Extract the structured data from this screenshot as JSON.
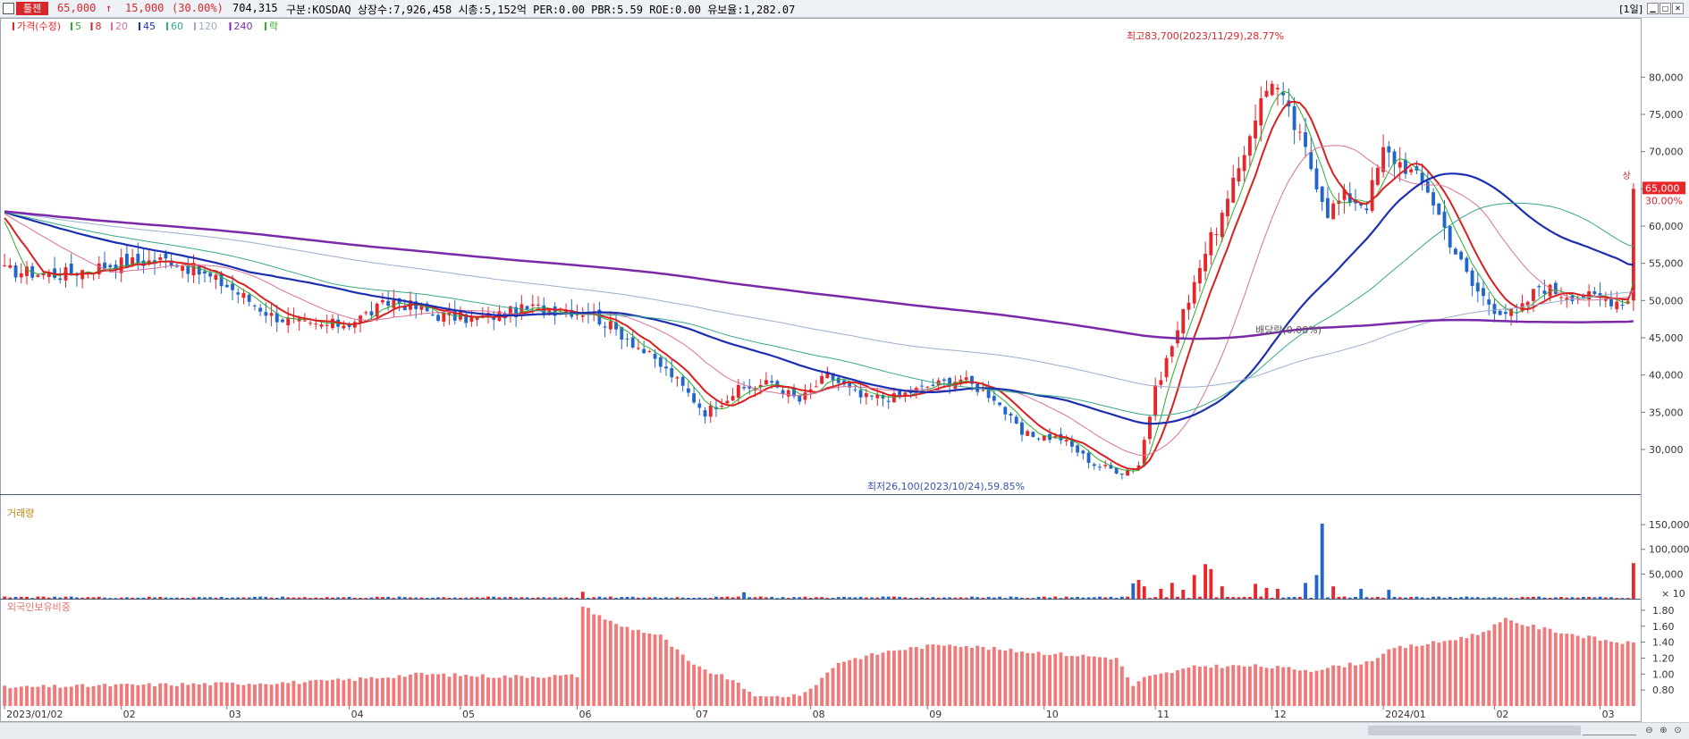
{
  "header": {
    "stock_name": "툴젠",
    "price": "65,000",
    "change_arrow": "↑",
    "change": "15,000",
    "change_pct": "(30.00%)",
    "volume": "704,315",
    "info": "구분:KOSDAQ 상장수:7,926,458 시총:5,152억 PER:0.00 PBR:5.59 ROE:0.00 유보율:1,282.07",
    "period": "[1일]"
  },
  "colors": {
    "up": "#e8252a",
    "down": "#2266cc",
    "ma5": "#2eaa2e",
    "ma8": "#d92020",
    "ma20": "#d9709a",
    "ma45": "#1c2fb0",
    "ma60": "#36a88a",
    "ma120": "#9aaed0",
    "ma240": "#7a2aa8",
    "foreign": "#f07a7a"
  },
  "chart_data": [
    {
      "type": "candlestick",
      "name": "price",
      "legend": [
        {
          "label": "가격(수정)",
          "color": "#e8252a"
        },
        {
          "label": "5",
          "color": "#2eaa2e"
        },
        {
          "label": "8",
          "color": "#d92020"
        },
        {
          "label": "20",
          "color": "#d9709a"
        },
        {
          "label": "45",
          "color": "#1c2fb0"
        },
        {
          "label": "60",
          "color": "#36a88a"
        },
        {
          "label": "120",
          "color": "#9aaed0"
        },
        {
          "label": "240",
          "color": "#7a2aa8"
        },
        {
          "label": "락",
          "color": "#2eaa2e"
        }
      ],
      "ylim": [
        24000,
        87000
      ],
      "yticks": [
        30000,
        35000,
        40000,
        45000,
        50000,
        55000,
        60000,
        65000,
        70000,
        75000,
        80000
      ],
      "ytick_labels": [
        "30,000",
        "35,000",
        "40,000",
        "45,000",
        "50,000",
        "55,000",
        "60,000",
        "65,000",
        "70,000",
        "75,000",
        "80,000"
      ],
      "x_labels": [
        "2023/01/02",
        "02",
        "03",
        "04",
        "05",
        "06",
        "07",
        "08",
        "09",
        "10",
        "11",
        "12",
        "2024/01",
        "02",
        "03"
      ],
      "x_label_days": [
        0,
        21,
        40,
        62,
        82,
        103,
        124,
        145,
        166,
        187,
        207,
        228,
        248,
        268,
        287
      ],
      "close_path": [
        [
          0,
          54000
        ],
        [
          10,
          53500
        ],
        [
          20,
          55000
        ],
        [
          30,
          55500
        ],
        [
          40,
          52000
        ],
        [
          48,
          48000
        ],
        [
          55,
          46500
        ],
        [
          62,
          47000
        ],
        [
          70,
          50000
        ],
        [
          78,
          48000
        ],
        [
          85,
          47500
        ],
        [
          95,
          49000
        ],
        [
          105,
          48500
        ],
        [
          112,
          45000
        ],
        [
          120,
          40000
        ],
        [
          126,
          35000
        ],
        [
          132,
          38000
        ],
        [
          138,
          39000
        ],
        [
          143,
          36500
        ],
        [
          148,
          40000
        ],
        [
          154,
          37000
        ],
        [
          160,
          37000
        ],
        [
          166,
          38500
        ],
        [
          172,
          39500
        ],
        [
          178,
          37000
        ],
        [
          183,
          32000
        ],
        [
          190,
          31500
        ],
        [
          196,
          28000
        ],
        [
          201,
          27000
        ],
        [
          204,
          28000
        ],
        [
          207,
          38000
        ],
        [
          211,
          46000
        ],
        [
          215,
          55000
        ],
        [
          220,
          63000
        ],
        [
          225,
          75000
        ],
        [
          228,
          80000
        ],
        [
          231,
          75000
        ],
        [
          234,
          70000
        ],
        [
          238,
          62000
        ],
        [
          241,
          64000
        ],
        [
          245,
          63000
        ],
        [
          248,
          70000
        ],
        [
          252,
          68000
        ],
        [
          256,
          65000
        ],
        [
          260,
          58000
        ],
        [
          264,
          52000
        ],
        [
          268,
          49000
        ],
        [
          272,
          48000
        ],
        [
          276,
          52000
        ],
        [
          280,
          51000
        ],
        [
          285,
          50500
        ],
        [
          290,
          50000
        ],
        [
          292,
          50000
        ],
        [
          293,
          65000
        ]
      ],
      "high_annotation": "최고83,700(2023/11/29),28.77%",
      "low_annotation": "최저26,100(2023/10/24),59.85%",
      "right_annotation": "배당락(0.00%)",
      "current_price_label": "65,000",
      "current_change_label": "30.00%",
      "marker_label": "상"
    },
    {
      "type": "bar",
      "name": "거래량",
      "label": "거래량",
      "ylim": [
        0,
        190000
      ],
      "yticks": [
        50000,
        100000,
        150000
      ],
      "ytick_labels": [
        "50,000",
        "100,000",
        "150,000"
      ],
      "unit_label": "× 10",
      "spikes": [
        [
          104,
          14000
        ],
        [
          133,
          13000
        ],
        [
          203,
          31000
        ],
        [
          204,
          38000
        ],
        [
          205,
          25000
        ],
        [
          208,
          20000
        ],
        [
          210,
          32000
        ],
        [
          212,
          18000
        ],
        [
          214,
          48000
        ],
        [
          216,
          70000
        ],
        [
          217,
          60000
        ],
        [
          219,
          25000
        ],
        [
          225,
          30000
        ],
        [
          227,
          22000
        ],
        [
          229,
          20000
        ],
        [
          234,
          32000
        ],
        [
          236,
          48000
        ],
        [
          237,
          152000
        ],
        [
          239,
          25000
        ],
        [
          244,
          20000
        ],
        [
          249,
          18000
        ],
        [
          293,
          72000
        ]
      ]
    },
    {
      "type": "bar",
      "name": "외국인보유비중",
      "label": "외국인보유비중",
      "ylim": [
        0.6,
        1.9
      ],
      "yticks": [
        0.8,
        1.0,
        1.2,
        1.4,
        1.6,
        1.8
      ],
      "ytick_labels": [
        "0.80",
        "1.00",
        "1.20",
        "1.40",
        "1.60",
        "1.80"
      ],
      "path": [
        [
          0,
          0.83
        ],
        [
          20,
          0.86
        ],
        [
          40,
          0.88
        ],
        [
          55,
          0.9
        ],
        [
          62,
          0.93
        ],
        [
          75,
          1.0
        ],
        [
          90,
          0.97
        ],
        [
          103,
          0.98
        ],
        [
          104,
          1.85
        ],
        [
          110,
          1.62
        ],
        [
          118,
          1.48
        ],
        [
          124,
          1.1
        ],
        [
          130,
          0.95
        ],
        [
          136,
          0.7
        ],
        [
          144,
          0.75
        ],
        [
          150,
          1.15
        ],
        [
          160,
          1.3
        ],
        [
          170,
          1.38
        ],
        [
          180,
          1.3
        ],
        [
          190,
          1.25
        ],
        [
          200,
          1.2
        ],
        [
          203,
          0.85
        ],
        [
          205,
          0.95
        ],
        [
          215,
          1.1
        ],
        [
          225,
          1.1
        ],
        [
          235,
          1.05
        ],
        [
          245,
          1.15
        ],
        [
          250,
          1.32
        ],
        [
          258,
          1.4
        ],
        [
          265,
          1.5
        ],
        [
          270,
          1.68
        ],
        [
          276,
          1.58
        ],
        [
          282,
          1.5
        ],
        [
          288,
          1.42
        ],
        [
          293,
          1.38
        ]
      ]
    }
  ]
}
